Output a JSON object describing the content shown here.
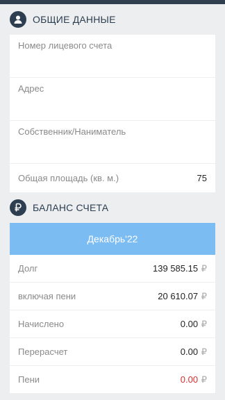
{
  "general": {
    "title": "ОБЩИЕ ДАННЫЕ",
    "icon": "user-icon",
    "fields": {
      "account_label": "Номер лицевого счета",
      "address_label": "Адрес",
      "owner_label": "Собственник/Наниматель",
      "area_label": "Общая площадь (кв. м.)",
      "area_value": "75"
    }
  },
  "balance": {
    "title": "БАЛАНС СЧЕТА",
    "icon": "ruble-icon",
    "period": "Декабрь'22",
    "currency": "₽",
    "rows": [
      {
        "label": "Долг",
        "value": "139 585.15"
      },
      {
        "label": "включая пени",
        "value": "20 610.07"
      },
      {
        "label": "Начислено",
        "value": "0.00"
      },
      {
        "label": "Перерасчет",
        "value": "0.00"
      },
      {
        "label": "Пени",
        "value": "0.00"
      }
    ]
  },
  "colors": {
    "header_dark": "#2f3f4f",
    "accent_blue": "#7bbcf2",
    "negative_red": "#d32f2f"
  }
}
